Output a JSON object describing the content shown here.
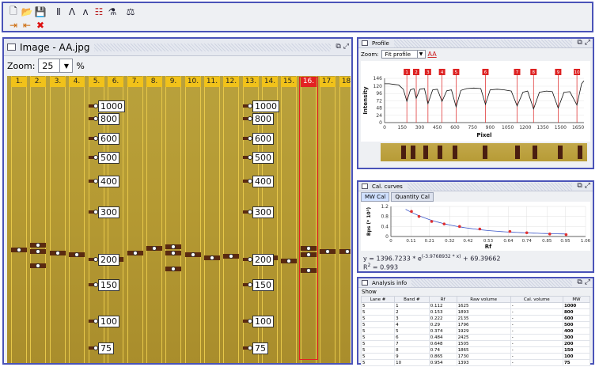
{
  "toolbar": {
    "row1": [
      "new-file-icon",
      "open-folder-icon",
      "save-icon",
      "lanes-icon",
      "profile-peaks-icon",
      "multi-peak-icon",
      "grid-lanes-icon",
      "flask-icon",
      "scale-icon"
    ],
    "row2": [
      "import-icon",
      "export-icon",
      "close-x-icon"
    ]
  },
  "image_window": {
    "title": "Image - AA.jpg",
    "zoom_label": "Zoom:",
    "zoom_value": "25",
    "zoom_unit": "%",
    "lanes": [
      "1.",
      "2.",
      "3.",
      "4.",
      "5.",
      "6.",
      "7.",
      "8.",
      "9.",
      "10.",
      "11.",
      "12.",
      "13.",
      "14.",
      "15.",
      "16.",
      "17.",
      "18."
    ],
    "selected_lane": "16.",
    "markers_left": [
      "1000",
      "800",
      "600",
      "500",
      "400",
      "300",
      "200",
      "150",
      "100",
      "75"
    ],
    "markers_right": [
      "1000",
      "800",
      "600",
      "500",
      "400",
      "300",
      "200",
      "150",
      "100",
      "75"
    ],
    "colors": {
      "lane_label": "#f1c21a",
      "selected": "#e32222",
      "gel": "#b59a33"
    }
  },
  "profile": {
    "title": "Profile",
    "zoom_label": "Zoom:",
    "zoom_value": "Fit profile",
    "aa_label": "AA",
    "chart_data": {
      "type": "line",
      "xlabel": "Pixel",
      "ylabel": "Intensity",
      "xticks": [
        "0",
        "150",
        "300",
        "450",
        "600",
        "750",
        "900",
        "1050",
        "1200",
        "1350",
        "1500",
        "1650"
      ],
      "yticks": [
        "0",
        "24",
        "48",
        "72",
        "96",
        "120",
        "146"
      ],
      "xlim": [
        0,
        1700
      ],
      "ylim": [
        0,
        146
      ],
      "peak_labels": [
        "1",
        "2",
        "3",
        "4",
        "5",
        "6",
        "7",
        "8",
        "9",
        "10"
      ],
      "peaks_x": [
        190,
        270,
        370,
        490,
        610,
        860,
        1130,
        1270,
        1480,
        1640
      ],
      "x": [
        0,
        40,
        80,
        120,
        160,
        190,
        220,
        250,
        270,
        300,
        340,
        370,
        410,
        450,
        490,
        530,
        570,
        610,
        650,
        700,
        760,
        820,
        860,
        900,
        960,
        1020,
        1080,
        1130,
        1180,
        1220,
        1270,
        1320,
        1380,
        1430,
        1480,
        1530,
        1580,
        1640,
        1680,
        1700
      ],
      "y": [
        128,
        128,
        126,
        124,
        110,
        70,
        108,
        112,
        80,
        110,
        112,
        62,
        108,
        110,
        70,
        105,
        108,
        52,
        106,
        112,
        114,
        112,
        60,
        108,
        110,
        108,
        104,
        55,
        100,
        104,
        45,
        100,
        104,
        102,
        48,
        100,
        102,
        58,
        128,
        138
      ]
    },
    "strip_bands": [
      190,
      270,
      370,
      490,
      610,
      860,
      1130,
      1270,
      1480,
      1640
    ]
  },
  "cal_curves": {
    "title": "Cal. curves",
    "tabs": [
      "MW Cal",
      "Quantity Cal"
    ],
    "chart_data": {
      "type": "scatter",
      "xlabel": "Rf",
      "ylabel": "Bps (* 10³)",
      "xticks": [
        "0",
        "0.11",
        "0.21",
        "0.32",
        "0.42",
        "0.53",
        "0.64",
        "0.74",
        "0.85",
        "0.95",
        "1.06"
      ],
      "yticks": [
        "0",
        "0.4",
        "0.8",
        "1.2"
      ],
      "xlim": [
        0,
        1.06
      ],
      "ylim": [
        0,
        1.2
      ],
      "points_x": [
        0.112,
        0.153,
        0.222,
        0.29,
        0.374,
        0.484,
        0.648,
        0.74,
        0.865,
        0.954
      ],
      "points_y": [
        1.0,
        0.8,
        0.6,
        0.5,
        0.4,
        0.3,
        0.2,
        0.15,
        0.1,
        0.075
      ]
    },
    "formula": "y = 1396.7233 * e",
    "formula_exp": "(-3.9768932 * x)",
    "formula_tail": " + 69.39662",
    "r2": "R",
    "r2_tail": " = 0.993"
  },
  "analysis": {
    "title": "Analysis info",
    "show_label": "Show",
    "columns": [
      "Lane #",
      "Band #",
      "Rf",
      "Raw volume",
      "Cal. volume",
      "MW"
    ],
    "rows": [
      [
        "5",
        "1",
        "0.112",
        "1625",
        "-",
        "1000"
      ],
      [
        "5",
        "2",
        "0.153",
        "1893",
        "-",
        "800"
      ],
      [
        "5",
        "3",
        "0.222",
        "2135",
        "-",
        "600"
      ],
      [
        "5",
        "4",
        "0.29",
        "1796",
        "-",
        "500"
      ],
      [
        "5",
        "5",
        "0.374",
        "1929",
        "-",
        "400"
      ],
      [
        "5",
        "6",
        "0.484",
        "2425",
        "-",
        "300"
      ],
      [
        "5",
        "7",
        "0.648",
        "1505",
        "-",
        "200"
      ],
      [
        "5",
        "8",
        "0.74",
        "1865",
        "-",
        "150"
      ],
      [
        "5",
        "9",
        "0.865",
        "1730",
        "-",
        "100"
      ],
      [
        "5",
        "10",
        "0.954",
        "1393",
        "-",
        "75"
      ]
    ]
  }
}
